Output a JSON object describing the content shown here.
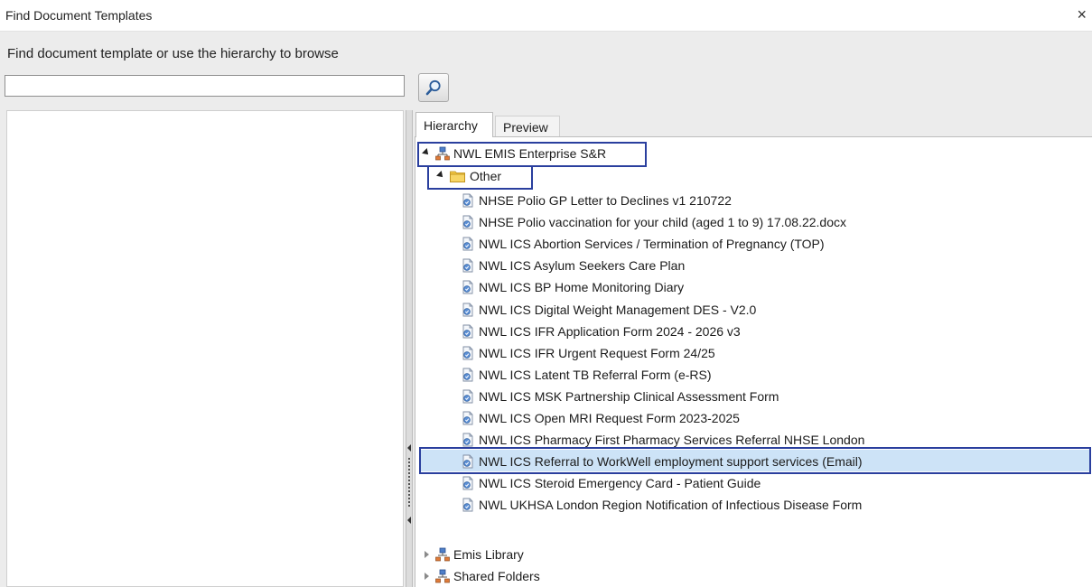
{
  "window": {
    "title": "Find Document Templates",
    "close_glyph": "×"
  },
  "search": {
    "prompt": "Find document template or use the hierarchy to browse",
    "value": "",
    "placeholder": ""
  },
  "tabs": [
    {
      "label": "Hierarchy",
      "active": true
    },
    {
      "label": "Preview",
      "active": false
    }
  ],
  "tree": {
    "root": {
      "label": "NWL EMIS Enterprise S&R",
      "icon": "org-hierarchy-icon",
      "expanded": true
    },
    "folder": {
      "label": "Other",
      "icon": "folder-icon",
      "expanded": true
    },
    "documents": [
      {
        "label": "NHSE Polio GP Letter to Declines v1 210722"
      },
      {
        "label": "NHSE Polio vaccination for your child (aged 1 to 9) 17.08.22.docx"
      },
      {
        "label": "NWL ICS Abortion Services / Termination of Pregnancy (TOP)"
      },
      {
        "label": "NWL ICS Asylum Seekers Care Plan"
      },
      {
        "label": "NWL ICS BP Home Monitoring Diary"
      },
      {
        "label": "NWL ICS Digital Weight Management DES - V2.0"
      },
      {
        "label": "NWL ICS IFR Application Form 2024 - 2026 v3"
      },
      {
        "label": "NWL ICS IFR Urgent Request Form 24/25"
      },
      {
        "label": "NWL ICS Latent TB Referral Form (e-RS)"
      },
      {
        "label": "NWL ICS MSK Partnership Clinical Assessment Form"
      },
      {
        "label": "NWL ICS Open MRI Request Form 2023-2025"
      },
      {
        "label": "NWL ICS Pharmacy First Pharmacy Services Referral NHSE London",
        "selected": true
      },
      {
        "label": "NWL ICS Referral to WorkWell employment support services (Email)"
      },
      {
        "label": "NWL ICS Steroid Emergency Card - Patient Guide"
      },
      {
        "label": "NWL UKHSA London Region Notification of Infectious Disease Form"
      }
    ],
    "collapsed_roots": [
      {
        "label": "Emis Library"
      },
      {
        "label": "Shared Folders"
      }
    ]
  },
  "colors": {
    "highlight_border": "#2a3f9e",
    "selection": "#cde3f7",
    "folder": "#f2c744"
  }
}
